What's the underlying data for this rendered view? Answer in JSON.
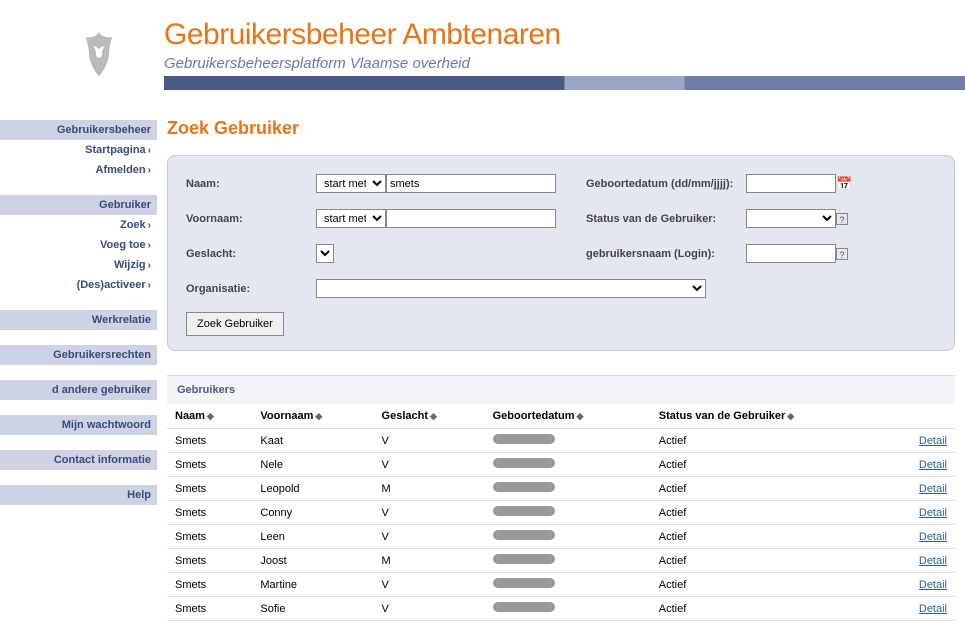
{
  "header": {
    "title": "Gebruikersbeheer Ambtenaren",
    "subtitle": "Gebruikersbeheersplatform Vlaamse overheid"
  },
  "sidebar": {
    "groups": [
      {
        "label": "Gebruikersbeheer",
        "items": [
          "Startpagina",
          "Afmelden"
        ]
      },
      {
        "label": "Gebruiker",
        "items": [
          "Zoek",
          "Voeg toe",
          "Wijzig",
          "(Des)activeer"
        ]
      }
    ],
    "singles": [
      "Werkrelatie",
      "Gebruikersrechten",
      "d andere gebruiker",
      "Mijn wachtwoord",
      "Contact informatie",
      "Help"
    ]
  },
  "page_title": "Zoek Gebruiker",
  "search": {
    "naam_label": "Naam:",
    "voornaam_label": "Voornaam:",
    "geslacht_label": "Geslacht:",
    "organisatie_label": "Organisatie:",
    "geboortedatum_label": "Geboortedatum (dd/mm/jjjj):",
    "status_label": "Status van de Gebruiker:",
    "login_label": "gebruikersnaam (Login):",
    "match_mode": "start met",
    "naam_value": "smets",
    "voornaam_value": "",
    "geboortedatum_value": "",
    "login_value": "",
    "button": "Zoek Gebruiker"
  },
  "results": {
    "title": "Gebruikers",
    "columns": {
      "naam": "Naam",
      "voornaam": "Voornaam",
      "geslacht": "Geslacht",
      "geboortedatum": "Geboortedatum",
      "status": "Status van de Gebruiker"
    },
    "detail_label": "Detail",
    "rows": [
      {
        "naam": "Smets",
        "voornaam": "Kaat",
        "geslacht": "V",
        "status": "Actief"
      },
      {
        "naam": "Smets",
        "voornaam": "Nele",
        "geslacht": "V",
        "status": "Actief"
      },
      {
        "naam": "Smets",
        "voornaam": "Leopold",
        "geslacht": "M",
        "status": "Actief"
      },
      {
        "naam": "Smets",
        "voornaam": "Conny",
        "geslacht": "V",
        "status": "Actief"
      },
      {
        "naam": "Smets",
        "voornaam": "Leen",
        "geslacht": "V",
        "status": "Actief"
      },
      {
        "naam": "Smets",
        "voornaam": "Joost",
        "geslacht": "M",
        "status": "Actief"
      },
      {
        "naam": "Smets",
        "voornaam": "Martine",
        "geslacht": "V",
        "status": "Actief"
      },
      {
        "naam": "Smets",
        "voornaam": "Sofie",
        "geslacht": "V",
        "status": "Actief"
      }
    ]
  }
}
